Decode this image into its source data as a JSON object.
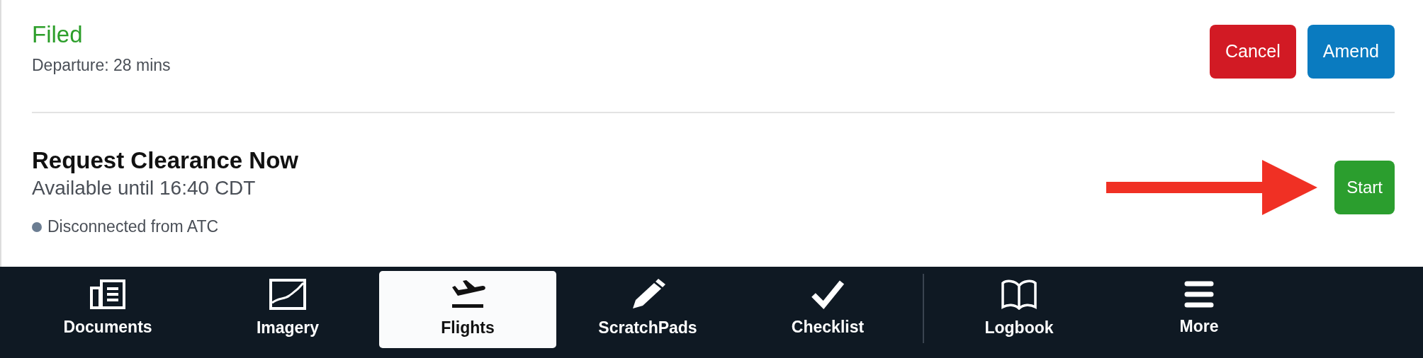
{
  "flight_plan": {
    "status": "Filed",
    "departure": "Departure: 28 mins",
    "actions": [
      {
        "label": "Cancel",
        "kind": "danger"
      },
      {
        "label": "Amend",
        "kind": "primary"
      }
    ]
  },
  "clearance": {
    "title": "Request Clearance Now",
    "availability": "Available until 16:40 CDT",
    "connection": "Disconnected from ATC",
    "pointer_arrow": true,
    "action": {
      "label": "Start",
      "kind": "success"
    }
  },
  "tab_groups": [
    [
      {
        "label": "Documents",
        "selected": false
      },
      {
        "label": "Imagery",
        "selected": false
      },
      {
        "label": "Flights",
        "selected": true
      },
      {
        "label": "ScratchPads",
        "selected": false
      },
      {
        "label": "Checklist",
        "selected": false
      }
    ],
    [
      {
        "label": "Logbook",
        "selected": false
      },
      {
        "label": "More",
        "selected": false
      }
    ]
  ]
}
